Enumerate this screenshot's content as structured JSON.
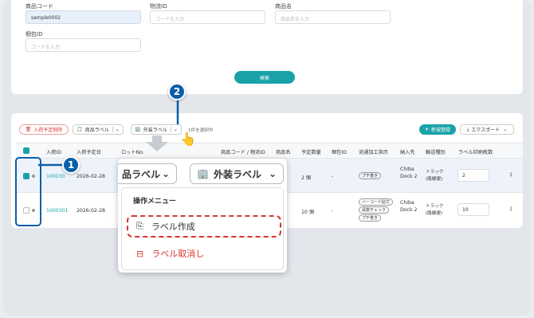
{
  "search": {
    "product_code_label": "商品コード",
    "product_code_value": "sample0002",
    "logistics_id_label": "物流ID",
    "logistics_id_placeholder": "コードを入力",
    "product_name_label": "商品名",
    "product_name_placeholder": "商品名を入力",
    "package_id_label": "梱包ID",
    "package_id_placeholder": "コードを入力",
    "search_button": "検索"
  },
  "toolbar": {
    "delete_button": "入荷予定削除",
    "product_label_button": "商品ラベル",
    "outer_label_button": "外装ラベル",
    "selection_status": "1件を選択中",
    "new_button": "新規登録",
    "export_button": "エクスポート"
  },
  "table": {
    "headers": [
      "入荷ID",
      "入荷予定日",
      "ロットNo.",
      "商品コード / 物流ID",
      "商品名",
      "予定数量",
      "梱包ID",
      "流通加工指示",
      "納入先",
      "輸送種別",
      "ラベル印刷枚数"
    ],
    "rows": [
      {
        "id": "100030",
        "date": "2026-02-28",
        "qty": "2 個",
        "pkg": "-",
        "tags": [
          "プチ巻き"
        ],
        "dest": "Chiba Dock 2",
        "transport": "トラック (路線便)",
        "print": "2",
        "checked": true
      },
      {
        "id": "1000301",
        "date": "2026-02-28",
        "qty": "10 個",
        "pkg": "-",
        "tags": [
          "バーコード貼付",
          "員数チェック",
          "プチ巻き"
        ],
        "dest": "Chiba Dock 2",
        "transport": "トラック (路線便)",
        "print": "10",
        "checked": false
      }
    ]
  },
  "zoom": {
    "product_label_button": "品ラベル",
    "outer_label_button": "外装ラベル",
    "menu_title": "操作メニュー",
    "create_label": "ラベル作成",
    "cancel_label": "ラベル取消し"
  },
  "callouts": {
    "one": "1",
    "two": "2"
  },
  "colors": {
    "teal": "#19a3a8",
    "red": "#d9362f",
    "callout_blue": "#0a5fa8"
  }
}
